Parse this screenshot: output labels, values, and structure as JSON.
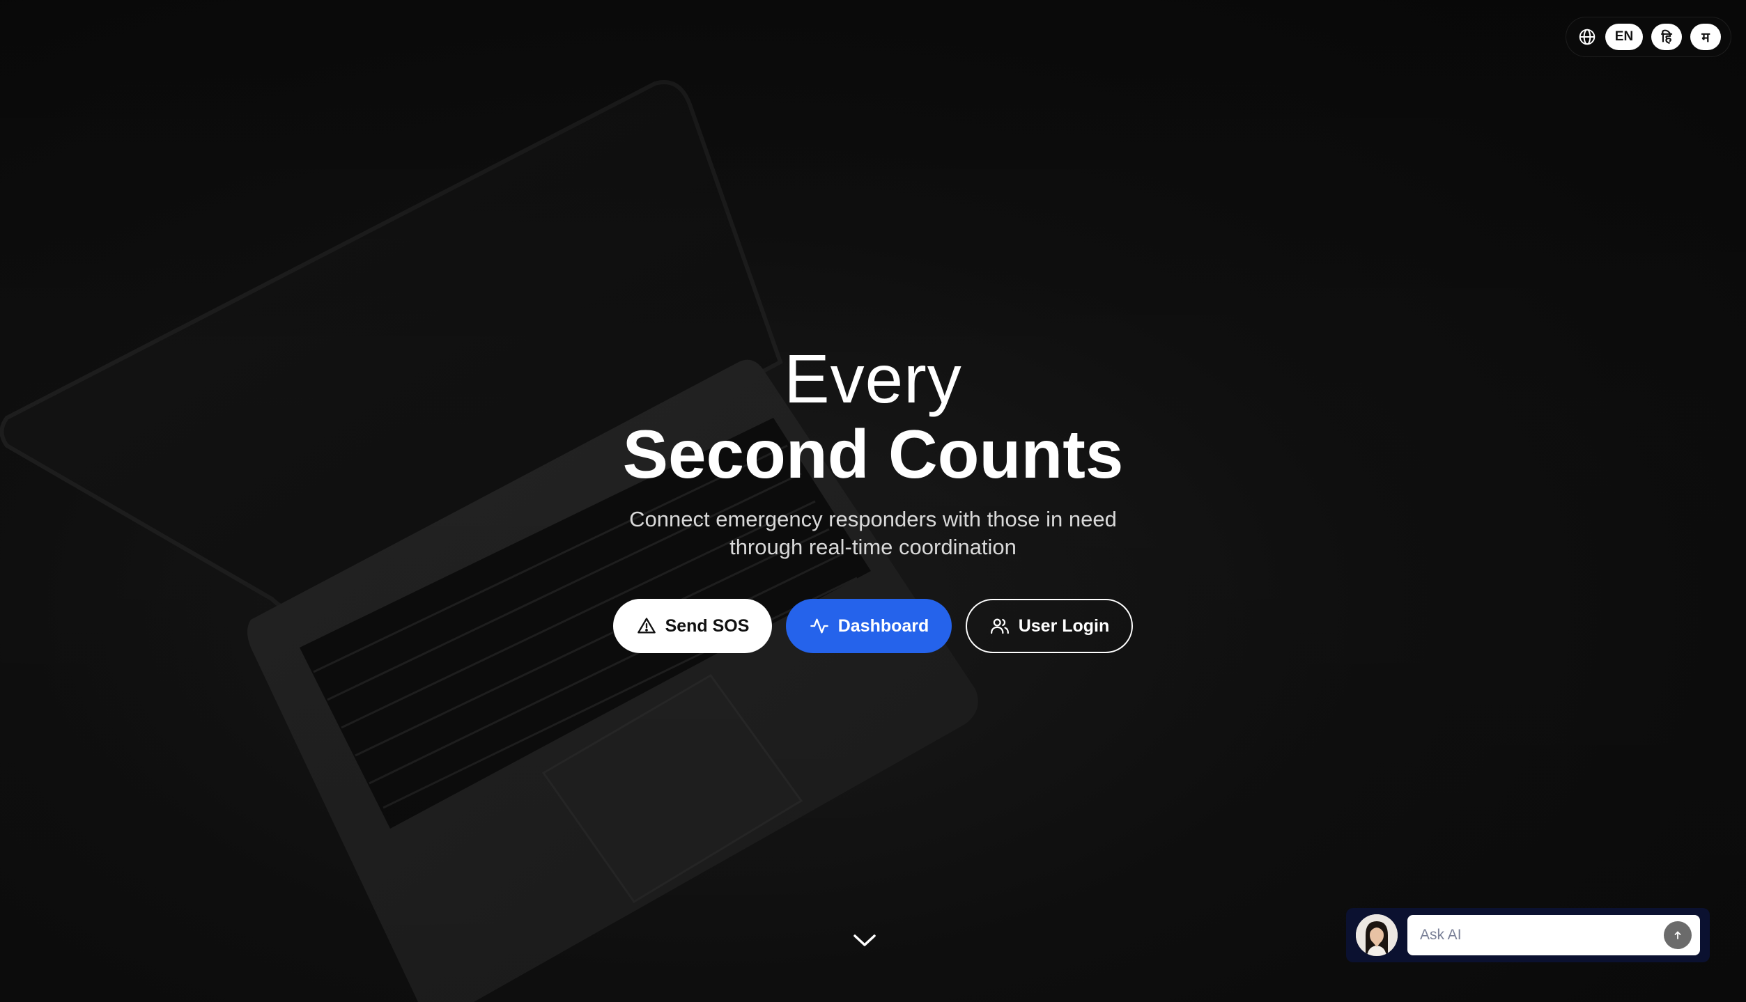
{
  "language_switcher": {
    "icon": "globe-icon",
    "options": [
      "EN",
      "हि",
      "म"
    ],
    "selected": "EN"
  },
  "hero": {
    "title_line1": "Every",
    "title_line2": "Second Counts",
    "subtitle_line1": "Connect emergency responders with those in need",
    "subtitle_line2": "through real-time coordination"
  },
  "actions": {
    "sos_label": "Send SOS",
    "sos_icon": "warning-triangle-icon",
    "dashboard_label": "Dashboard",
    "dashboard_icon": "activity-pulse-icon",
    "login_label": "User Login",
    "login_icon": "users-icon"
  },
  "scroll": {
    "icon": "chevron-down-icon"
  },
  "ai_chat": {
    "placeholder": "Ask AI",
    "send_icon": "arrow-up-icon"
  },
  "colors": {
    "background": "#0c0c0c",
    "primary_blue": "#2563eb",
    "white": "#ffffff",
    "chat_panel": "#0b1130"
  }
}
